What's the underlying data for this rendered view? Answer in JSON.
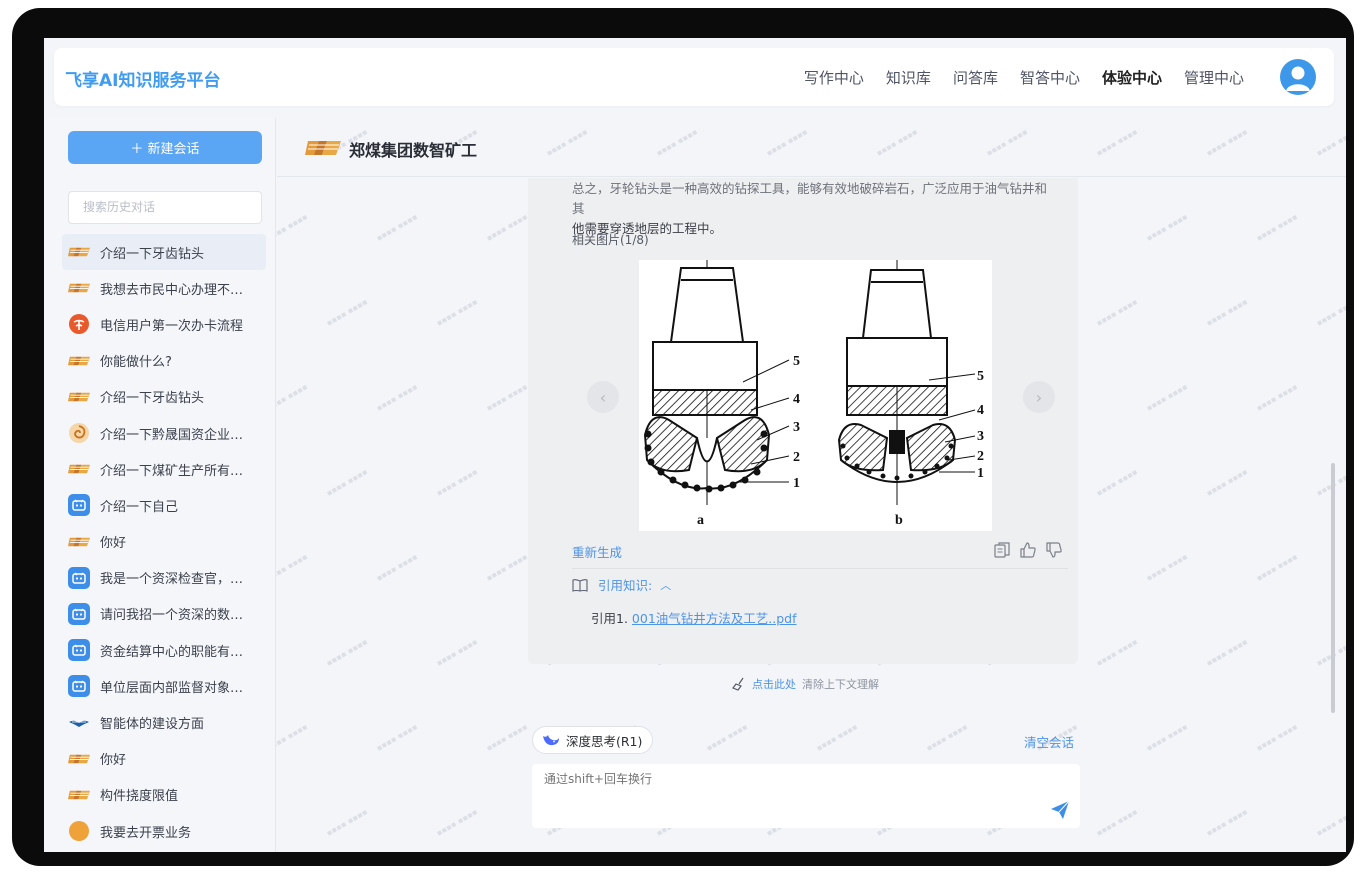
{
  "header": {
    "brand": "飞享AI知识服务平台",
    "nav": [
      "写作中心",
      "知识库",
      "问答库",
      "智答中心",
      "体验中心",
      "管理中心"
    ],
    "active_nav": "体验中心"
  },
  "sidebar": {
    "new_chat_label": "＋ 新建会话",
    "search_placeholder": "搜索历史对话",
    "items": [
      {
        "label": "介绍一下牙齿钻头",
        "icon": "zm-logo-icon"
      },
      {
        "label": "我想去市民中心办理不动产登记",
        "icon": "zm-logo-icon"
      },
      {
        "label": "电信用户第一次办卡流程",
        "icon": "telecom-logo-icon"
      },
      {
        "label": "你能做什么?",
        "icon": "zm-logo-icon"
      },
      {
        "label": "介绍一下牙齿钻头",
        "icon": "zm-logo-icon"
      },
      {
        "label": "介绍一下黔晟国资企业集团",
        "icon": "swirl-logo-icon"
      },
      {
        "label": "介绍一下煤矿生产所有环节",
        "icon": "zm-logo-icon"
      },
      {
        "label": "介绍一下自己",
        "icon": "robot-icon"
      },
      {
        "label": "你好",
        "icon": "zm-logo-icon"
      },
      {
        "label": "我是一个资深检查官，请帮我",
        "icon": "robot-icon"
      },
      {
        "label": "请问我招一个资深的数据分析师",
        "icon": "robot-icon"
      },
      {
        "label": "资金结算中心的职能有哪些",
        "icon": "robot-icon"
      },
      {
        "label": "单位层面内部监督对象有哪些",
        "icon": "robot-icon"
      },
      {
        "label": "智能体的建设方面",
        "icon": "wing-logo-icon"
      },
      {
        "label": "你好",
        "icon": "zm-logo-icon"
      },
      {
        "label": "构件挠度限值",
        "icon": "zm-logo-icon"
      },
      {
        "label": "我要去开票业务",
        "icon": "orange-logo-icon"
      }
    ]
  },
  "chat": {
    "title": "郑煤集团数智矿工",
    "message": {
      "text_line1": "总之，牙轮钻头是一种高效的钻探工具，能够有效地破碎岩石，广泛应用于油气钻井和其",
      "text_line2": "他需要穿透地层的工程中。",
      "images_label": "相关图片(1/8)",
      "diagram_labels": {
        "left": "a",
        "right": "b",
        "numbers": [
          "5",
          "4",
          "3",
          "2",
          "1"
        ]
      },
      "regenerate": "重新生成",
      "cite_label": "引用知识:",
      "cite_prefix": "引用1.",
      "cite_file": "001油气钻井方法及工艺..pdf"
    },
    "clear_tip_link": "点击此处",
    "clear_tip_text": "清除上下文理解",
    "deep_think": "深度思考(R1)",
    "clear_session": "清空会话",
    "input_placeholder": "通过shift+回车换行"
  },
  "colors": {
    "accent": "#4d93e6",
    "brand": "#3f9cf0",
    "new_button": "#5aa6f5"
  }
}
